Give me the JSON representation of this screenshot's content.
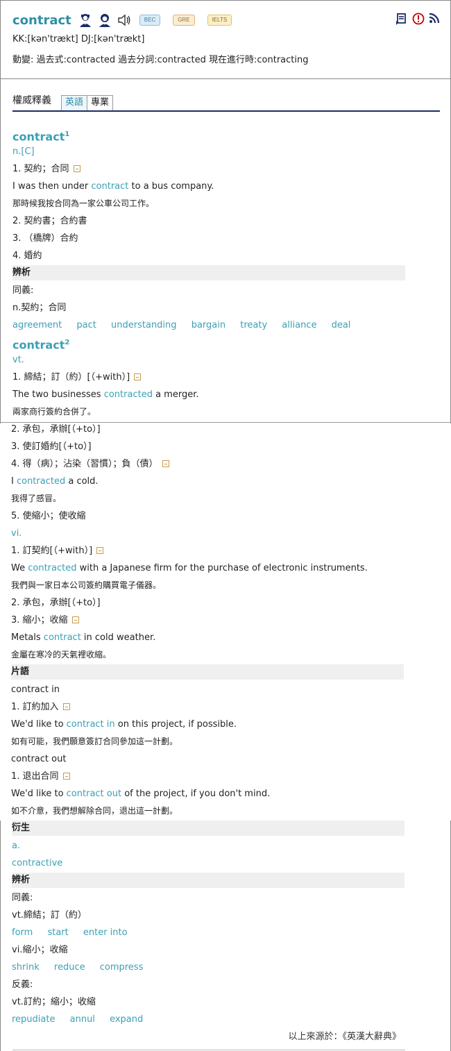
{
  "header": {
    "word": "contract",
    "pronunciation": "KK:[kən'trækt] DJ:[kən'trækt]",
    "forms": "動變: 過去式:contracted  過去分詞:contracted  現在進行時:contracting",
    "tags": [
      "BEC",
      "GRE",
      "IELTS"
    ]
  },
  "tabs": {
    "title": "權威釋義",
    "items": [
      "英語",
      "專業"
    ]
  },
  "entry1": {
    "word": "contract",
    "sup": "1",
    "pos": "n.[C]",
    "s1": "1. 契約；合同",
    "ex1_pre": "I was then under ",
    "ex1_hl": "contract",
    "ex1_post": " to a bus company.",
    "ex1_zh": "那時候我按合同為一家公車公司工作。",
    "s2": "2. 契約書；合約書",
    "s3": "3. （橋牌）合約",
    "s4": "4. 婚約",
    "analysis": "辨析",
    "syn_label": "同義:",
    "syn_sense": "n.契約；合同",
    "syns": [
      "agreement",
      "pact",
      "understanding",
      "bargain",
      "treaty",
      "alliance",
      "deal"
    ]
  },
  "entry2": {
    "word": "contract",
    "sup": "2",
    "pos": "vt.",
    "s1": "1. 締結；訂（約）[（+with）]",
    "ex1_pre": "The two businesses ",
    "ex1_hl": "contracted",
    "ex1_post": " a merger.",
    "ex1_zh": "兩家商行簽約合併了。",
    "s2": "2. 承包，承辦[（+to）]",
    "s3": "3. 使訂婚約[（+to）]",
    "s4": "4. 得（病）；沾染（習慣）；負（債）",
    "ex4_pre": "I ",
    "ex4_hl": "contracted",
    "ex4_post": " a cold.",
    "ex4_zh": "我得了感冒。",
    "s5": "5. 使縮小；使收縮",
    "pos2": "vi.",
    "v1": "1. 訂契約[（+with）]",
    "exv1_pre": "We ",
    "exv1_hl": "contracted",
    "exv1_post": " with a Japanese firm for the purchase of electronic instruments.",
    "exv1_zh": "我們與一家日本公司簽約購買電子儀器。",
    "v2": "2. 承包，承辦[（+to）]",
    "v3": "3. 縮小；收縮",
    "exv3_pre": "Metals ",
    "exv3_hl": "contract",
    "exv3_post": " in cold weather.",
    "exv3_zh": "金屬在寒冷的天氣裡收縮。"
  },
  "phrases": {
    "title": "片語",
    "p1": "contract in",
    "p1_s": "1. 訂約加入",
    "p1_pre": "We'd like to ",
    "p1_hl": "contract in",
    "p1_post": " on this project, if possible.",
    "p1_zh": "如有可能，我們願意簽訂合同參加這一計劃。",
    "p2": "contract out",
    "p2_s": "1. 退出合同",
    "p2_pre": "We'd like to ",
    "p2_hl": "contract out",
    "p2_post": " of the project, if you don't mind.",
    "p2_zh": "如不介意，我們想解除合同，退出這一計劃。"
  },
  "derived": {
    "title": "衍生",
    "pos": "a.",
    "word": "contractive"
  },
  "analysis2": {
    "title": "辨析",
    "syn_label": "同義:",
    "vt_sense": "vt.締結；訂（約）",
    "vt_syns": [
      "form",
      "start",
      "enter into"
    ],
    "vi_sense": "vi.縮小；收縮",
    "vi_syns": [
      "shrink",
      "reduce",
      "compress"
    ],
    "ant_label": "反義:",
    "ant_sense": "vt.訂約；縮小；收縮",
    "ant_syns": [
      "repudiate",
      "annul",
      "expand"
    ]
  },
  "source": "以上來源於：《英漢大辭典》"
}
